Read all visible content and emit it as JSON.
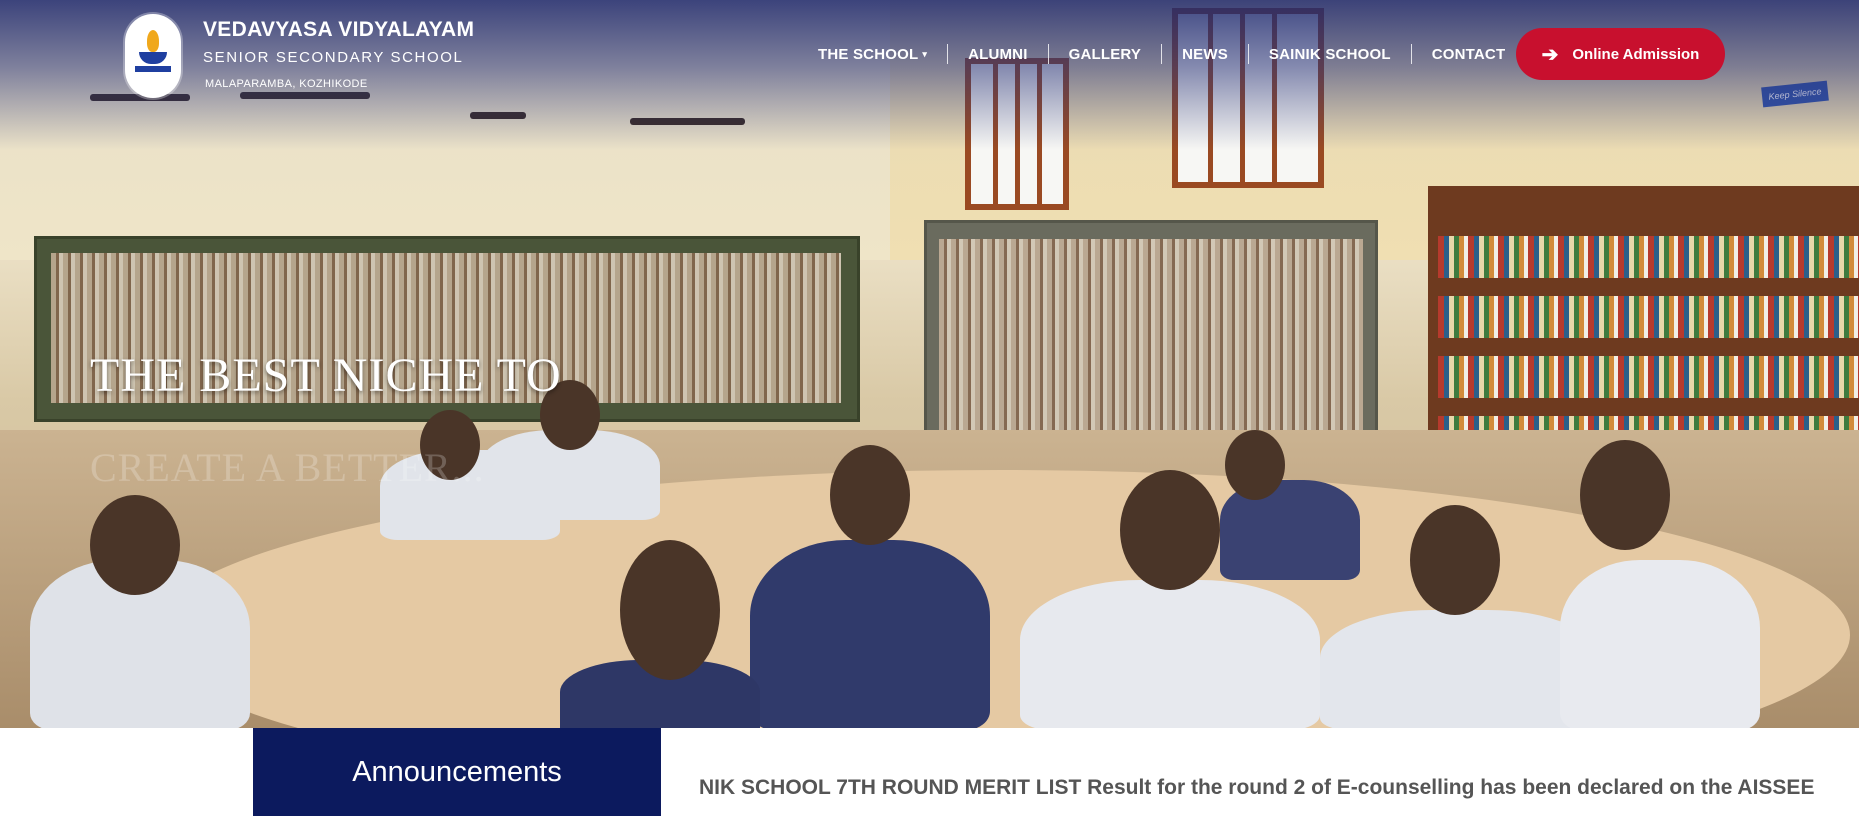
{
  "brand": {
    "name": "VEDAVYASA VIDYALAYAM",
    "subtitle": "SENIOR SECONDARY SCHOOL",
    "location": "MALAPARAMBA, KOZHIKODE"
  },
  "nav": {
    "items": [
      {
        "label": "THE SCHOOL",
        "has_dropdown": true
      },
      {
        "label": "ALUMNI"
      },
      {
        "label": "GALLERY"
      },
      {
        "label": "NEWS"
      },
      {
        "label": "SAINIK SCHOOL"
      },
      {
        "label": "CONTACT"
      }
    ],
    "caret_glyph": "▾"
  },
  "cta": {
    "label": "Online Admission",
    "icon": "arrow-right-icon",
    "color": "#c8102e"
  },
  "hero": {
    "title": "THE BEST NICHE TO",
    "ghost_text": "CREATE A BETTER..."
  },
  "slider": {
    "prev_glyph": "‹",
    "next_glyph": "›"
  },
  "announcements": {
    "label": "Announcements",
    "ticker": "NIK SCHOOL 7TH ROUND MERIT LIST Result for the round 2 of E-counselling has been declared on the AISSEE"
  },
  "colors": {
    "accent_red": "#c8102e",
    "navy": "#0c1a5e"
  }
}
